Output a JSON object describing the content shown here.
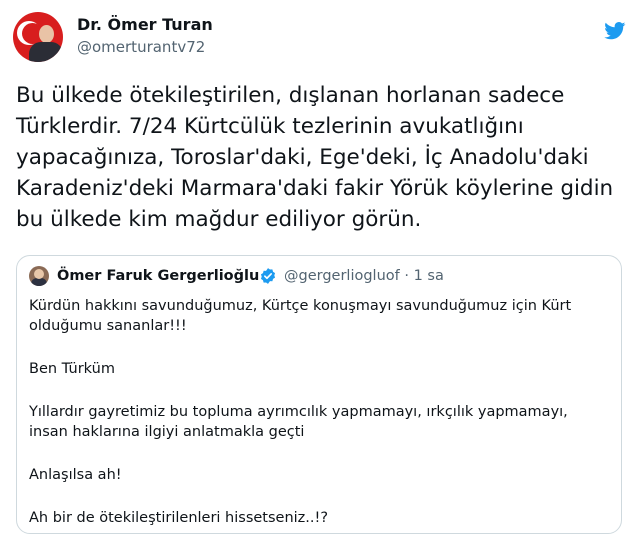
{
  "tweet": {
    "author_name": "Dr. Ömer Turan",
    "author_handle": "@omerturantv72",
    "text": "Bu ülkede ötekileştirilen, dışlanan horlanan sadece\nTürklerdir. 7/24 Kürtcülük tezlerinin avukatlığını\nyapacağınıza, Toroslar'daki, Ege'deki, İç Anadolu'daki\nKaradeniz'deki Marmara'daki fakir Yörük köylerine gidin\nbu ülkede kim mağdur ediliyor görün."
  },
  "quoted_tweet": {
    "author_name": "Ömer Faruk Gergerlioğlu",
    "author_handle": "@gergerliogluof · 1 sa",
    "paragraphs": [
      "Kürdün hakkını savunduğumuz, Kürtçe konuşmayı savunduğumuz için Kürt olduğumu sananlar!!!",
      "Ben Türküm",
      "Yıllardır gayretimiz bu topluma ayrımcılık yapmamayı, ırkçılık yapmamayı, insan haklarına ilgiyi anlatmakla geçti",
      "Anlaşılsa ah!",
      "Ah bir de ötekileştirilenleri hissetseniz..!?"
    ]
  },
  "icons": {
    "platform_logo": "twitter-bird-icon",
    "verified": "verified-badge-icon"
  },
  "colors": {
    "accent": "#1d9bf0",
    "secondary_text": "#536471",
    "border": "#cfd9de"
  }
}
